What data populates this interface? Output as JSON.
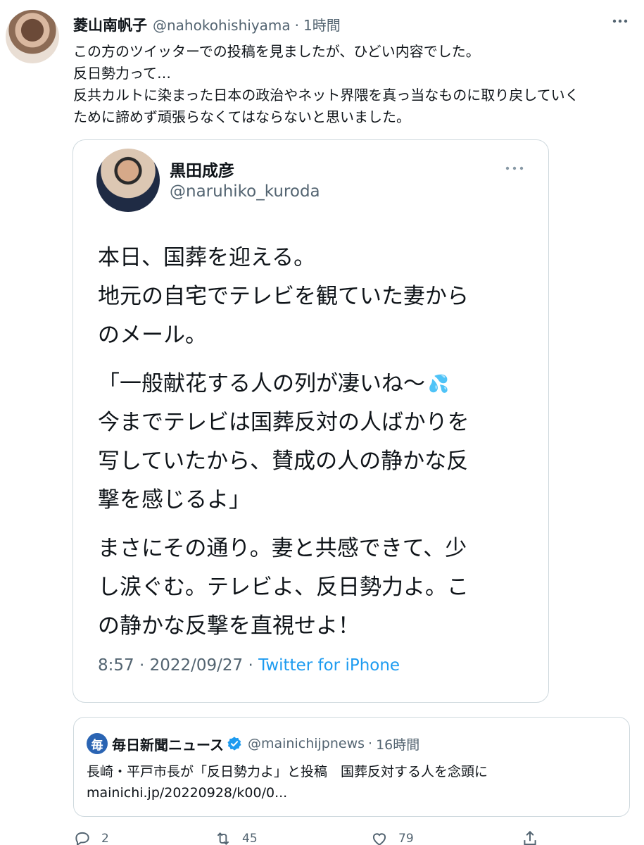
{
  "tweet": {
    "author": {
      "display_name": "菱山南帆子",
      "handle": "@nahokohishiyama",
      "time": "1時間"
    },
    "text_lines": [
      "この方のツイッターでの投稿を見ましたが、ひどい内容でした。",
      "反日勢力って…",
      "反共カルトに染まった日本の政治やネット界隈を真っ当なものに取り戻していく",
      "ために諦めず頑張らなくてはならないと思いました。"
    ],
    "separator": "·"
  },
  "embedded": {
    "display_name": "黒田成彦",
    "handle": "@naruhiko_kuroda",
    "paragraphs": [
      [
        "本日、国葬を迎える。",
        "地元の自宅でテレビを観ていた妻から",
        "のメール。"
      ],
      [
        "「一般献花する人の列が凄いね〜",
        "今までテレビは国葬反対の人ばかりを",
        "写していたから、賛成の人の静かな反",
        "撃を感じるよ」"
      ],
      [
        "まさにその通り。妻と共感できて、少",
        "し涙ぐむ。テレビよ、反日勢力よ。こ",
        "の静かな反撃を直視せよ！"
      ]
    ],
    "emoji": "💦",
    "meta_time": "8:57",
    "meta_date": "2022/09/27",
    "meta_source": "Twitter for iPhone"
  },
  "quote": {
    "logo_char": "毎",
    "display_name": "毎日新聞ニュース",
    "handle": "@mainichijpnews",
    "time": "16時間",
    "text_line1": "長崎・平戸市長が「反日勢力よ」と投稿　国葬反対する人を念頭に",
    "text_line2": "mainichi.jp/20220928/k00/0..."
  },
  "actions": {
    "reply_count": "2",
    "retweet_count": "45",
    "like_count": "79"
  },
  "colors": {
    "text": "#0f1419",
    "secondary": "#536471",
    "link": "#1d9bf0",
    "border": "#cfd9de",
    "mainichi_blue": "#2a64b3"
  }
}
